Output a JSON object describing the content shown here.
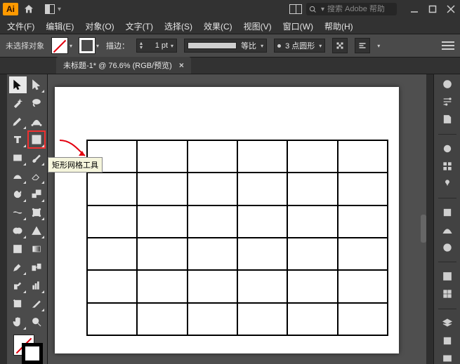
{
  "app": {
    "logo_text": "Ai"
  },
  "search": {
    "placeholder": "搜索 Adobe 帮助"
  },
  "menu": {
    "file": "文件(F)",
    "edit": "编辑(E)",
    "object": "对象(O)",
    "type": "文字(T)",
    "select": "选择(S)",
    "effect": "效果(C)",
    "view": "视图(V)",
    "window": "窗口(W)",
    "help": "帮助(H)"
  },
  "controlbar": {
    "selection_status": "未选择对象",
    "stroke_label": "描边：",
    "stroke_value": "1 pt",
    "scale_label": "等比",
    "brush_value": "3 点圆形"
  },
  "document": {
    "tab_label": "未标题-1* @ 76.6% (RGB/预览)",
    "close": "×"
  },
  "tooltip": {
    "grid_tool": "矩形网格工具"
  },
  "grid": {
    "rows": 6,
    "cols": 6
  },
  "colors": {
    "accent": "#ff9a00",
    "highlight": "#f03030"
  }
}
